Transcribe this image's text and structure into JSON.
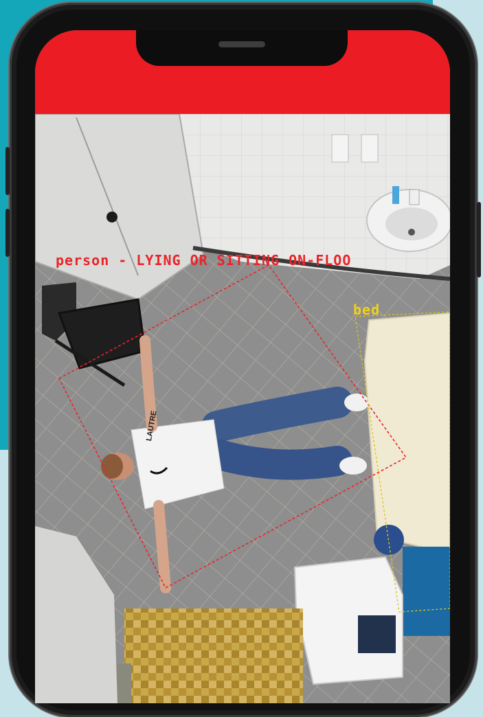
{
  "screen": {
    "header_color": "#ec1c24",
    "accent_color": "#14a6b9"
  },
  "detections": {
    "person_label": "person - LYING OR SITTING ON-FLOO",
    "bed_label": "bed",
    "person_box_color": "#e8252a",
    "bed_box_color": "#f2d11b"
  },
  "scene": {
    "shirt_print": "LAUTRE"
  }
}
